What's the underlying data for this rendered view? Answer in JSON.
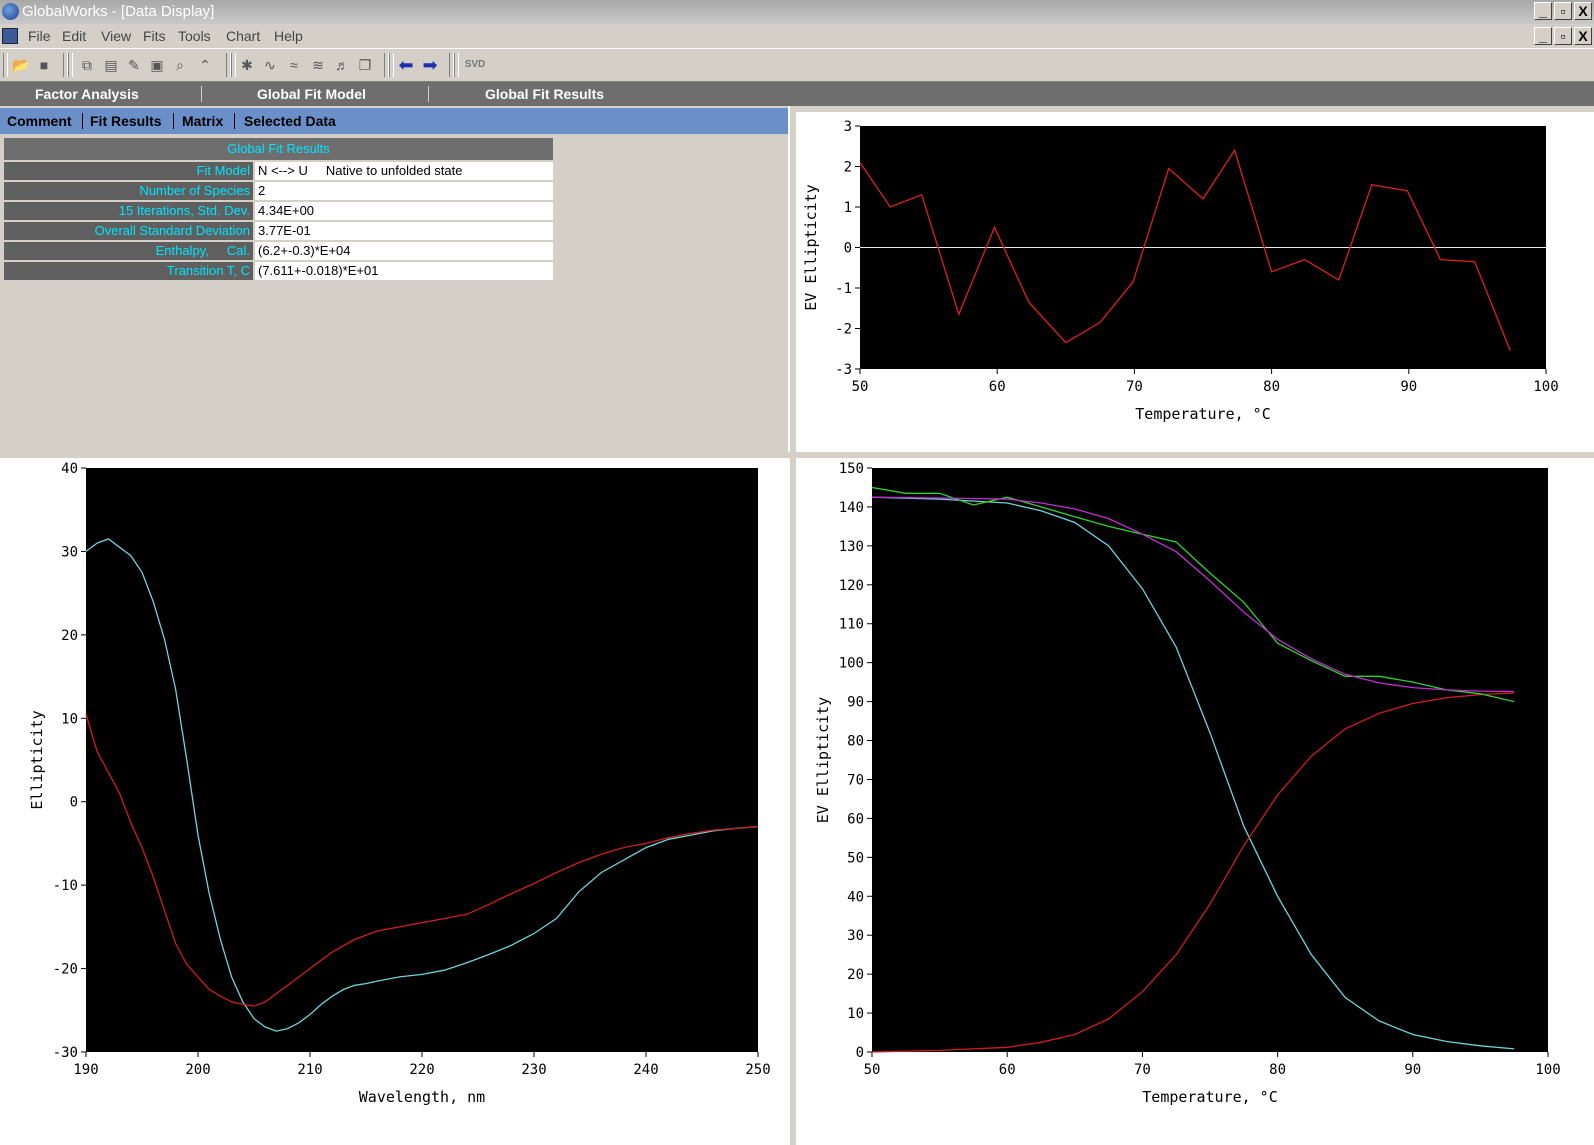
{
  "window": {
    "title": "GlobalWorks - [Data Display]",
    "buttons": [
      "_",
      "▫",
      "X"
    ]
  },
  "menu": [
    "File",
    "Edit",
    "View",
    "Fits",
    "Tools",
    "Chart",
    "Help"
  ],
  "toolbar": {
    "svd_label": "SVD"
  },
  "modes": [
    "Factor Analysis",
    "Global Fit Model",
    "Global Fit Results"
  ],
  "subtabs": [
    "Comment",
    "Fit Results",
    "Matrix",
    "Selected Data"
  ],
  "results": {
    "header": "Global Fit Results",
    "rows": [
      {
        "label": "Fit Model",
        "value": "N <--> U     Native to unfolded state"
      },
      {
        "label": "Number of Species",
        "value": "2"
      },
      {
        "label": "15 Iterations, Std. Dev.",
        "value": "4.34E+00"
      },
      {
        "label": "Overall Standard Deviation",
        "value": "3.77E-01"
      },
      {
        "label": "Enthalpy,     Cal.",
        "value": "(6.2+-0.3)*E+04"
      },
      {
        "label": "Transition T, C",
        "value": "(7.611+-0.018)*E+01"
      }
    ]
  },
  "chart_data": [
    {
      "id": "residuals",
      "type": "line",
      "xlabel": "Temperature, °C",
      "ylabel": "EV Ellipticity",
      "xlim": [
        50,
        100
      ],
      "ylim": [
        -3,
        3
      ],
      "xticks": [
        50,
        60,
        70,
        80,
        90,
        100
      ],
      "yticks": [
        -3,
        -2,
        -1,
        0,
        1,
        2,
        3
      ],
      "zero_line": true,
      "series": [
        {
          "color": "#e0201c",
          "x": [
            50,
            52.2,
            54.5,
            57.2,
            59.8,
            62.3,
            65,
            67.5,
            69.9,
            72.5,
            75,
            77.3,
            80,
            82.4,
            84.9,
            87.3,
            89.9,
            92.3,
            94.8,
            97.4
          ],
          "y": [
            2.1,
            1.0,
            1.3,
            -1.65,
            0.5,
            -1.35,
            -2.35,
            -1.85,
            -0.85,
            1.95,
            1.2,
            2.4,
            -0.6,
            -0.3,
            -0.8,
            1.55,
            1.4,
            -0.3,
            -0.35,
            -2.55
          ]
        }
      ]
    },
    {
      "id": "spectra",
      "type": "line",
      "xlabel": "Wavelength, nm",
      "ylabel": "Ellipticity",
      "xlim": [
        190,
        250
      ],
      "ylim": [
        -30,
        40
      ],
      "xticks": [
        190,
        200,
        210,
        220,
        230,
        240,
        250
      ],
      "yticks": [
        -30,
        -20,
        -10,
        0,
        10,
        20,
        30,
        40
      ],
      "series": [
        {
          "color": "#6ed3dc",
          "x": [
            190,
            191,
            192,
            193,
            194,
            195,
            196,
            197,
            198,
            199,
            200,
            201,
            202,
            203,
            204,
            205,
            206,
            207,
            208,
            209,
            210,
            211,
            212,
            213,
            214,
            215,
            216,
            218,
            220,
            222,
            224,
            226,
            228,
            230,
            232,
            234,
            236,
            238,
            240,
            242,
            244,
            246,
            248,
            250
          ],
          "y": [
            30,
            31,
            31.5,
            30.5,
            29.5,
            27.5,
            24,
            19.5,
            13.5,
            5,
            -4,
            -11,
            -16.5,
            -21,
            -24,
            -26,
            -27,
            -27.5,
            -27.2,
            -26.5,
            -25.5,
            -24.3,
            -23.3,
            -22.5,
            -22,
            -21.8,
            -21.5,
            -21,
            -20.7,
            -20.2,
            -19.3,
            -18.3,
            -17.2,
            -15.8,
            -14,
            -10.8,
            -8.5,
            -7,
            -5.5,
            -4.5,
            -4,
            -3.5,
            -3.2,
            -3
          ]
        },
        {
          "color": "#d01e1e",
          "x": [
            190,
            191,
            192,
            193,
            194,
            195,
            196,
            197,
            198,
            199,
            200,
            201,
            202,
            203,
            204,
            205,
            206,
            207,
            208,
            209,
            210,
            211,
            212,
            214,
            216,
            218,
            220,
            222,
            224,
            226,
            228,
            230,
            232,
            234,
            236,
            238,
            240,
            242,
            244,
            246,
            248,
            250
          ],
          "y": [
            10.5,
            6,
            3.5,
            1,
            -2.5,
            -5.5,
            -9,
            -13,
            -17,
            -19.5,
            -21,
            -22.5,
            -23.3,
            -24,
            -24.3,
            -24.5,
            -24,
            -23,
            -22,
            -21,
            -20,
            -19,
            -18,
            -16.5,
            -15.5,
            -15,
            -14.5,
            -14,
            -13.5,
            -12.3,
            -11,
            -9.8,
            -8.5,
            -7.3,
            -6.3,
            -5.5,
            -5,
            -4.3,
            -3.8,
            -3.4,
            -3.2,
            -3
          ]
        }
      ]
    },
    {
      "id": "fractions",
      "type": "line",
      "xlabel": "Temperature, °C",
      "ylabel": "EV Ellipticity",
      "xlim": [
        50,
        100
      ],
      "ylim": [
        0,
        150
      ],
      "xticks": [
        50,
        60,
        70,
        80,
        90,
        100
      ],
      "yticks": [
        0,
        10,
        20,
        30,
        40,
        50,
        60,
        70,
        80,
        90,
        100,
        110,
        120,
        130,
        140,
        150
      ],
      "series": [
        {
          "color": "#6ed3dc",
          "x": [
            50,
            55,
            60,
            62.5,
            65,
            67.5,
            70,
            72.5,
            75,
            77.5,
            80,
            82.5,
            85,
            87.5,
            90,
            92.5,
            95,
            97.5
          ],
          "y": [
            142.5,
            142,
            141,
            139,
            136,
            130,
            119,
            104,
            82,
            58,
            40,
            25,
            14,
            8,
            4.5,
            2.7,
            1.6,
            0.8
          ]
        },
        {
          "color": "#d01e1e",
          "x": [
            50,
            55,
            60,
            62.5,
            65,
            67.5,
            70,
            72.5,
            75,
            77.5,
            80,
            82.5,
            85,
            87.5,
            90,
            92.5,
            95,
            97.5
          ],
          "y": [
            0,
            0.4,
            1.2,
            2.5,
            4.5,
            8.5,
            15.5,
            25,
            38,
            53,
            66,
            76,
            83,
            87,
            89.5,
            91,
            91.8,
            92.2
          ]
        },
        {
          "color": "#2bd42b",
          "x": [
            50,
            52.5,
            55,
            57.5,
            60,
            62.5,
            65,
            67.5,
            70,
            72.5,
            75,
            77.5,
            80,
            82.5,
            85,
            87.5,
            90,
            92.5,
            95,
            97.5
          ],
          "y": [
            145,
            143.5,
            143.5,
            140.5,
            142.5,
            140,
            137.5,
            135,
            133,
            131,
            123,
            115.5,
            105,
            100.5,
            96.5,
            96.5,
            95,
            93,
            92,
            90
          ]
        },
        {
          "color": "#c62bd4",
          "x": [
            50,
            55,
            60,
            62.5,
            65,
            67.5,
            70,
            72.5,
            75,
            77.5,
            80,
            82.5,
            85,
            87.5,
            90,
            92.5,
            95,
            97.5
          ],
          "y": [
            142.5,
            142.3,
            142,
            141,
            139.5,
            137,
            133,
            128.5,
            121,
            113,
            106,
            101,
            97,
            94.8,
            93.6,
            93,
            92.7,
            92.6
          ]
        }
      ]
    }
  ]
}
